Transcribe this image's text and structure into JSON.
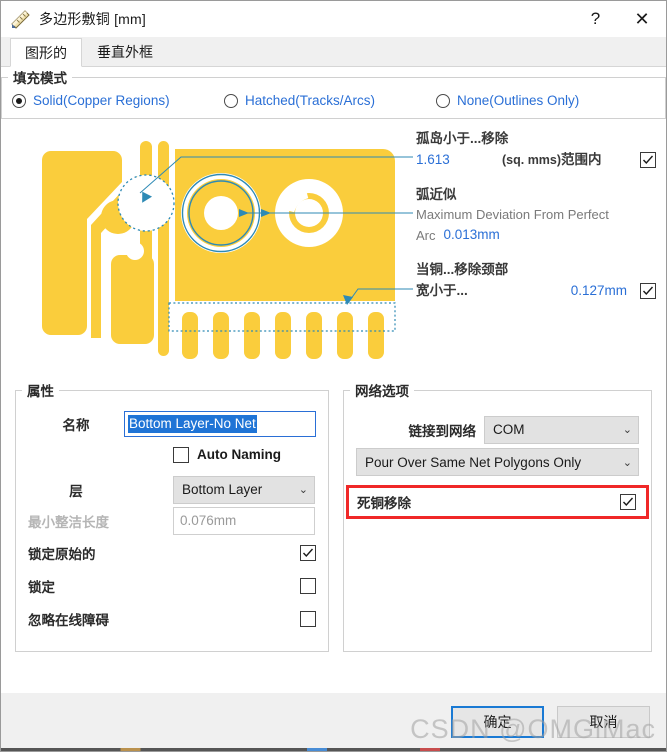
{
  "window": {
    "title": "多边形敷铜",
    "title_unit": "[mm]",
    "icon": "ruler-triangle-icon",
    "help_glyph": "?",
    "close_glyph": "✕"
  },
  "tabs": [
    {
      "label": "图形的",
      "active": true
    },
    {
      "label": "垂直外框",
      "active": false
    }
  ],
  "fill_mode": {
    "title": "填充模式",
    "options": [
      {
        "label": "Solid(Copper Regions)",
        "selected": true
      },
      {
        "label": "Hatched(Tracks/Arcs)",
        "selected": false
      },
      {
        "label": "None(Outlines Only)",
        "selected": false
      }
    ]
  },
  "callouts": {
    "island": {
      "title": "孤岛小于...移除",
      "value": "1.613",
      "unit": "(sq. mms)",
      "suffix": "范围内",
      "checked": true
    },
    "arc": {
      "title": "弧近似",
      "desc_line1": "Maximum Deviation From Perfect",
      "desc_line2": "Arc",
      "value": "0.013mm"
    },
    "neck": {
      "title": "当铜...移除颈部",
      "label": "宽小于...",
      "value": "0.127mm",
      "checked": true
    }
  },
  "properties": {
    "title": "属性",
    "name_label": "名称",
    "name_value": "Bottom Layer-No Net",
    "auto_naming_label": "Auto Naming",
    "auto_naming_checked": false,
    "layer_label": "层",
    "layer_value": "Bottom Layer",
    "min_prim_label": "最小整洁长度",
    "min_prim_value": "0.076mm",
    "lock_primitives_label": "锁定原始的",
    "lock_primitives_checked": true,
    "locked_label": "锁定",
    "locked_checked": false,
    "ignore_label": "忽略在线障碍",
    "ignore_checked": false
  },
  "net_options": {
    "title": "网络选项",
    "connect_label": "链接到网络",
    "connect_value": "COM",
    "pour_value": "Pour Over Same Net Polygons Only",
    "remove_dead_label": "死铜移除",
    "remove_dead_checked": true,
    "highlight_color": "#f02828"
  },
  "footer": {
    "ok_label": "确定",
    "cancel_label": "取消",
    "watermark": "CSDN @OMGiMac"
  },
  "colors": {
    "copper": "#facd3c",
    "accent_blue": "#2a6fd6",
    "annotation_blue": "#2e8ab5",
    "selection_blue": "#1f74d6"
  }
}
